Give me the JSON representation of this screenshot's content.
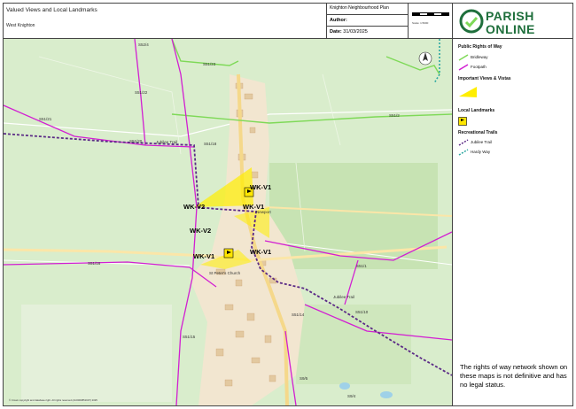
{
  "header": {
    "title": "Valued Views and Local Landmarks",
    "area": "West Knighton",
    "plan_name": "Knighton Neighbourhood Plan",
    "author_label": "Author:",
    "date_label": "Date:",
    "date_value": "31/03/2025",
    "scale_text": "Scale: 1:5000"
  },
  "brand": {
    "line1": "PARISH",
    "line2": "ONLINE"
  },
  "legend": {
    "prow_heading": "Public Rights of Way",
    "bridleway": "Bridleway",
    "footpath": "Footpath",
    "views_heading": "Important Views & Vistas",
    "landmarks_heading": "Local Landmarks",
    "trails_heading": "Recreational Trails",
    "jubilee": "Jubilee Trail",
    "hardy": "Hardy Way",
    "colors": {
      "bridleway": "#7ed957",
      "footpath": "#d21fd2",
      "jubilee": "#5b2a86",
      "hardy": "#2aa7a0",
      "view": "#ffee00"
    }
  },
  "disclaimer": "The rights of way network shown on these maps is not definitive and has no legal status.",
  "copyright": "© Crown copyright and database right. All rights reserved (AC0000851607) 2025",
  "map_labels": {
    "path_labels": [
      "S52/4",
      "S51/23",
      "S51/22",
      "S51/21",
      "S51/20",
      "S51/18",
      "S51/2",
      "S51/1",
      "S51/16",
      "S51/10",
      "S51/14",
      "S51/15",
      "S9/5",
      "S9/4"
    ],
    "trail_labels": [
      "Jubilee Trail",
      "Jubilee Trail"
    ],
    "view_labels": [
      "WK-V1",
      "WK-V1",
      "WK-V1",
      "WK-V2",
      "WK-V2",
      "WK-V1"
    ],
    "place_labels": [
      "St Peter's Church",
      "Newport"
    ]
  }
}
